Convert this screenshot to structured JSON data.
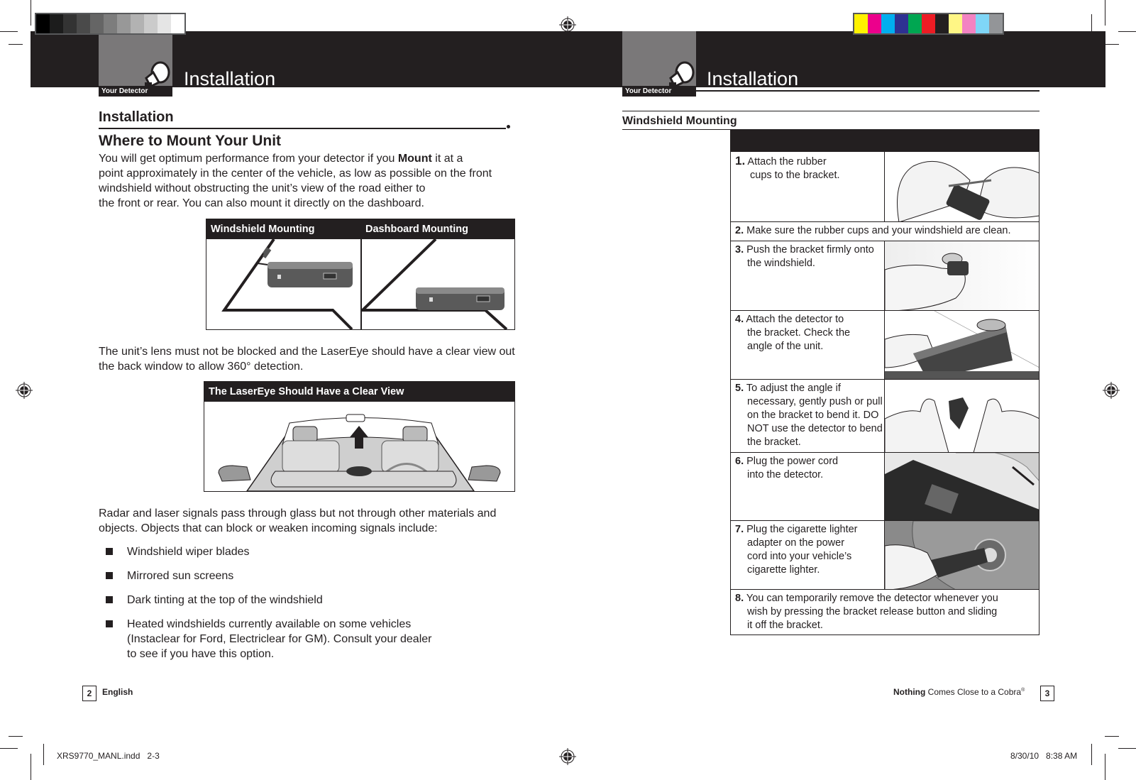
{
  "colors": {
    "ink": "#231f20",
    "tab_gray": "#7a7879",
    "grayscale_swatches": [
      "#000000",
      "#1c1c1c",
      "#333333",
      "#4a4a4a",
      "#656565",
      "#7d7d7d",
      "#989898",
      "#b2b2b2",
      "#cbcbcb",
      "#e5e5e5",
      "#ffffff"
    ],
    "color_swatches": [
      "#fff200",
      "#ec008c",
      "#00aeef",
      "#2e3192",
      "#00a651",
      "#ed1c24",
      "#231f20",
      "#fff685",
      "#f383c2",
      "#7fd6f7",
      "#939598"
    ]
  },
  "left_page": {
    "header": {
      "tab_label": "Your Detector",
      "title": "Installation",
      "icon": "satellite-dish-icon"
    },
    "section_heading": "Installation",
    "subheading": "Where to Mount Your Unit",
    "intro": {
      "lines": [
        {
          "before": "You will get optimum performance from your detector if you ",
          "bold": "Mount",
          "after": " it at a"
        },
        {
          "before": "point approximately in the center of the vehicle, as low as possible on the front",
          "bold": "",
          "after": ""
        },
        {
          "before": "windshield without obstructing the unit’s view of the road either to",
          "bold": "",
          "after": ""
        },
        {
          "before": "the front or rear. You can also mount it directly on the dashboard.",
          "bold": "",
          "after": ""
        }
      ]
    },
    "mount_figure": {
      "windshield_label": "Windshield Mounting",
      "dashboard_label": "Dashboard Mounting"
    },
    "lens_text": [
      "The unit’s lens must not be blocked and the LaserEye should have a clear view out",
      "the back window to allow 360° detection."
    ],
    "lasereye_figure": {
      "label": "The LaserEye Should Have a Clear View"
    },
    "signals_text": [
      "Radar and laser signals pass through glass but not through other materials and",
      "objects. Objects that can block or weaken incoming signals include:"
    ],
    "bullets": [
      {
        "lines": [
          "Windshield wiper blades"
        ]
      },
      {
        "lines": [
          "Mirrored sun screens"
        ]
      },
      {
        "lines": [
          "Dark tinting at the top of the windshield"
        ]
      },
      {
        "lines": [
          "Heated windshields currently available on some vehicles",
          "(Instaclear for Ford, Electriclear for GM). Consult your dealer",
          "to see if you have this option."
        ]
      }
    ],
    "footer": {
      "page_number": "2",
      "language": "English"
    }
  },
  "right_page": {
    "header": {
      "tab_label": "Your Detector",
      "title": "Installation",
      "icon": "satellite-dish-icon"
    },
    "section_heading": "Windshield Mounting",
    "steps": [
      {
        "num": "1.",
        "lines": [
          "Attach the rubber",
          "cups to the bracket."
        ],
        "has_image": true
      },
      {
        "num": "2.",
        "lines": [
          "Make sure the rubber cups and your windshield are clean."
        ],
        "has_image": false
      },
      {
        "num": "3.",
        "lines": [
          "Push the bracket firmly onto",
          "the windshield."
        ],
        "has_image": true
      },
      {
        "num": "4.",
        "lines": [
          "Attach the detector to",
          "the bracket. Check the",
          "angle of the unit."
        ],
        "has_image": true
      },
      {
        "num": "5.",
        "lines": [
          "To adjust the angle if",
          "necessary, gently push or pull",
          "on the bracket to bend it. DO",
          "NOT use the detector to bend",
          "the bracket."
        ],
        "has_image": true
      },
      {
        "num": "6.",
        "lines": [
          "Plug the power cord",
          "into the detector."
        ],
        "has_image": true
      },
      {
        "num": "7.",
        "lines": [
          "Plug the cigarette lighter",
          "adapter on the power",
          "cord into your vehicle’s",
          "cigarette lighter."
        ],
        "has_image": true
      },
      {
        "num": "8.",
        "lines": [
          "You can temporarily remove the detector whenever you",
          "wish by pressing the bracket release button and sliding",
          "it off the bracket."
        ],
        "has_image": false
      }
    ],
    "footer": {
      "tagline_bold": "Nothing",
      "tagline_rest": " Comes Close to a Cobra",
      "registered": "®",
      "page_number": "3"
    }
  },
  "slug": {
    "filename": "XRS9770_MANL.indd   2-3",
    "timestamp": "8/30/10   8:38 AM"
  }
}
